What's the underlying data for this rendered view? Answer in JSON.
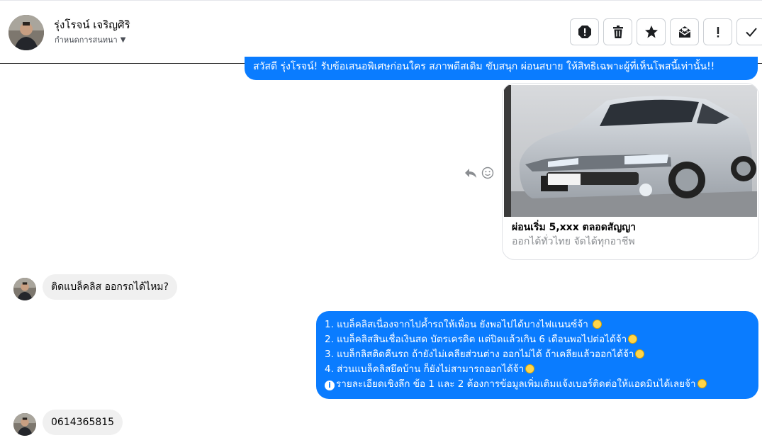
{
  "header": {
    "contact_name": "รุ่งโรจน์ เจริญศิริ",
    "contact_sub": "กำหนดการสนทนา",
    "actions": [
      {
        "name": "report-icon"
      },
      {
        "name": "trash-icon"
      },
      {
        "name": "star-icon"
      },
      {
        "name": "mark-unread-icon"
      },
      {
        "name": "exclamation-icon"
      },
      {
        "name": "check-icon"
      }
    ]
  },
  "messages": {
    "banner": "สวัสดี รุ่งโรจน์! รับข้อเสนอพิเศษก่อนใคร สภาพดีสเดิม ขับสนุก ผ่อนสบาย ให้สิทธิเฉพาะผู้ที่เห็นโพสนี้เท่านั้น!!",
    "card": {
      "title": "ผ่อนเริ่ม 5,xxx ตลอดสัญญา",
      "subtitle": "ออกได้ทั่วไทย จัดได้ทุกอาชีพ"
    },
    "question": "ติดแบล็คลิส ออกรถได้ไหม?",
    "answer": {
      "line1": "1. แบล็คลิสเนื่องจากไปค้ำรถให้เพื่อน ยังพอไปได้บางไฟแนนซ์จ้า",
      "line2": "2. แบล็คลิสสินเชื่อเงินสด บัตรเครดิต แต่ปิดแล้วเกิน 6 เดือนพอไปต่อได้จ้า",
      "line3": "3. แบล็กลิสติดคืนรถ ถ้ายังไม่เคลียส่วนต่าง ออกไม่ได้ ถ้าเคลียแล้วออกได้จ้า",
      "line4": "4. ส่วนแบล็คลิสยึดบ้าน ก็ยังไม่สามารถออกได้จ้า",
      "line5": "รายละเอียดเชิงลึก ข้อ 1 และ 2 ต้องการข้อมูลเพิ่มเติมแจ้งเบอร์ติดต่อให้แอดมินได้เลยจ้า"
    },
    "phone": "0614365815"
  },
  "colors": {
    "outgoing": "#0a7cff",
    "incoming": "#f0f0f0"
  }
}
